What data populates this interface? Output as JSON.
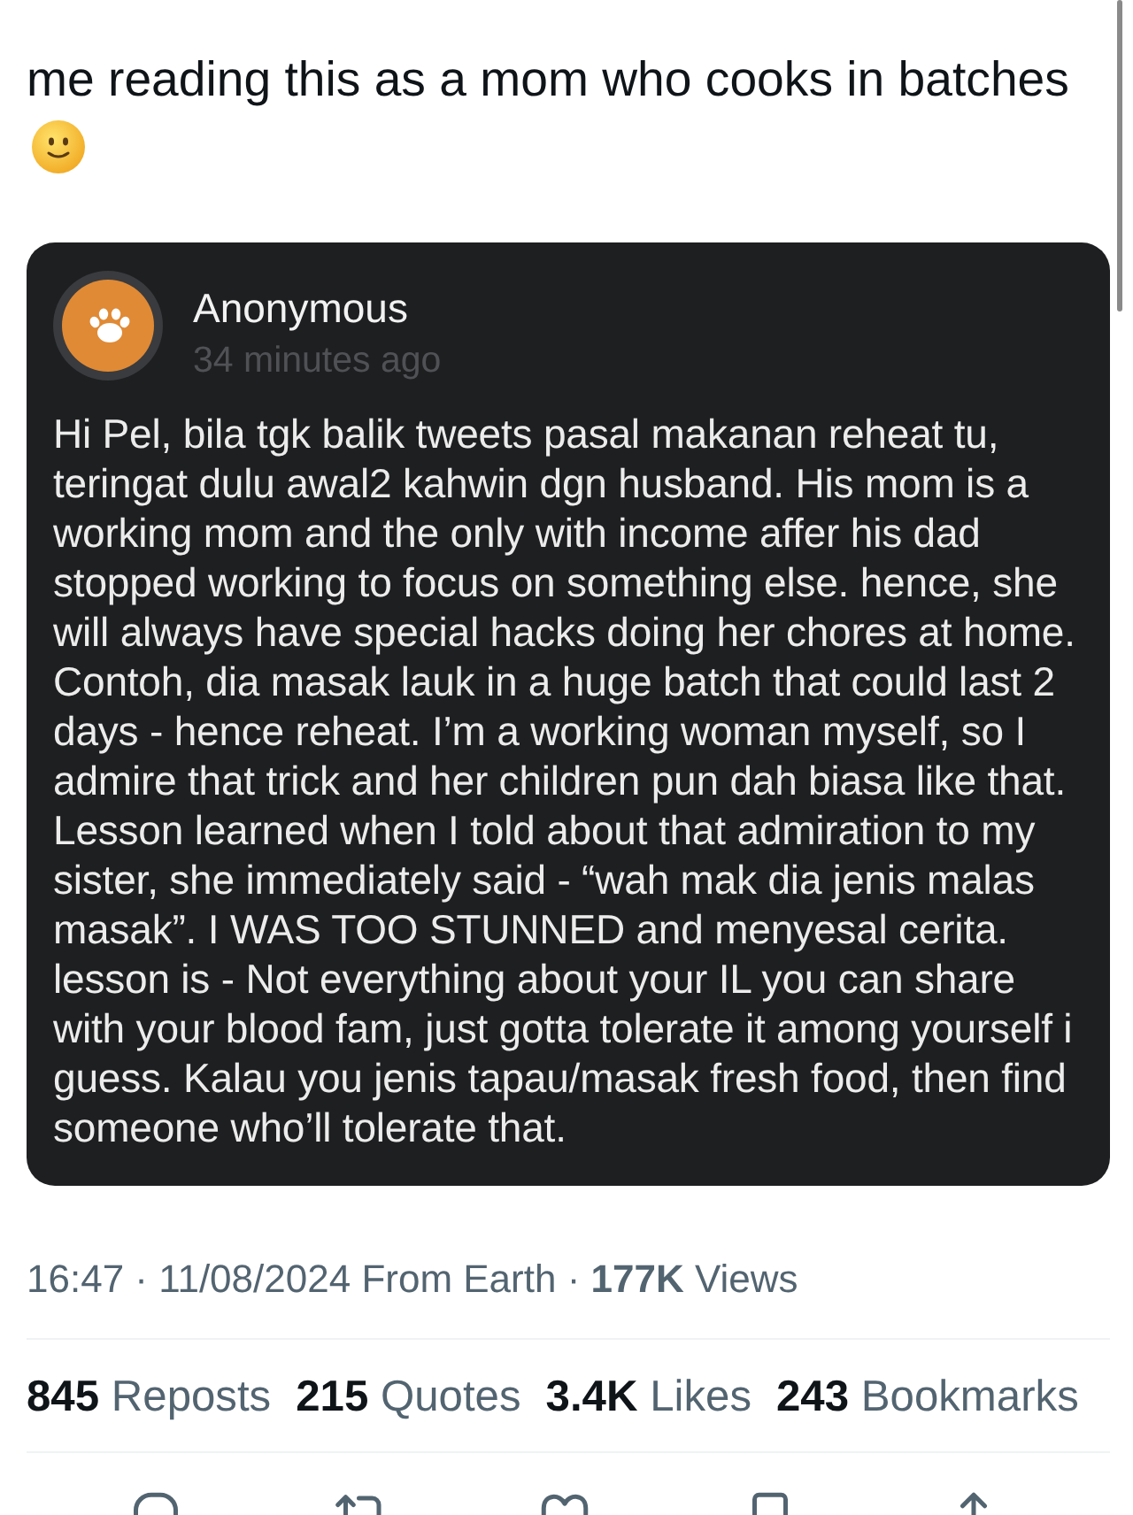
{
  "tweet": {
    "text": "me reading this as a mom who cooks in batches"
  },
  "attached_post": {
    "author": "Anonymous",
    "time": "34 minutes ago",
    "body": "Hi Pel, bila tgk balik tweets pasal makanan reheat tu, teringat dulu awal2 kahwin dgn husband. His mom is a working mom and the only with income affer his dad stopped working to focus on something else. hence, she will always have special hacks doing her chores at home. Contoh, dia masak lauk in a huge batch that could last 2 days - hence reheat. I’m a working woman myself, so I admire that trick and her children pun dah biasa like that. Lesson learned when I told about that admiration to my sister, she immediately said - “wah mak dia jenis malas masak”. I WAS TOO STUNNED and menyesal cerita. lesson is - Not everything about your IL you can share with your blood fam, just gotta tolerate it among yourself i guess. Kalau you jenis tapau/masak fresh food, then find someone who’ll tolerate that."
  },
  "meta": "16:47 · 11/08/2024 From Earth · **177K** Views",
  "stats": [
    {
      "count": "845",
      "label": "Reposts"
    },
    {
      "count": "215",
      "label": "Quotes"
    },
    {
      "count": "3.4K",
      "label": "Likes"
    },
    {
      "count": "243",
      "label": "Bookmarks"
    }
  ]
}
